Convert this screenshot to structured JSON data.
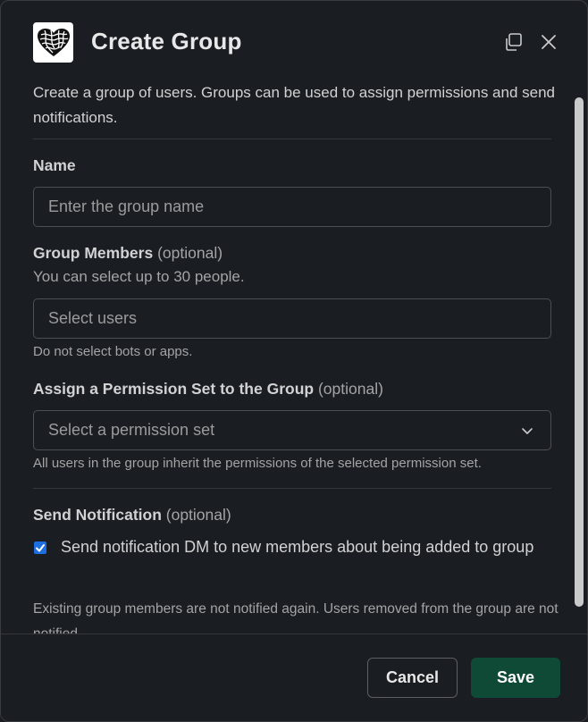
{
  "header": {
    "title": "Create Group",
    "icons": {
      "app": "heart-knot-logo-icon",
      "copy": "copy-icon",
      "close": "close-icon"
    }
  },
  "intro": "Create a group of users. Groups can be used to assign permissions and send notifications.",
  "name_field": {
    "label": "Name",
    "placeholder": "Enter the group name",
    "value": ""
  },
  "members_field": {
    "label": "Group Members",
    "optional": "(optional)",
    "sublabel": "You can select up to 30 people.",
    "placeholder": "Select users",
    "hint": "Do not select bots or apps."
  },
  "permission_field": {
    "label": "Assign a Permission Set to the Group",
    "optional": "(optional)",
    "placeholder": "Select a permission set",
    "hint": "All users in the group inherit the permissions of the selected permission set."
  },
  "notification": {
    "label": "Send Notification",
    "optional": "(optional)",
    "checkbox_label": "Send notification DM to new members about being added to group",
    "checked": true,
    "note": "Existing group members are not notified again. Users removed from the group are not notified."
  },
  "footer": {
    "cancel_label": "Cancel",
    "save_label": "Save"
  },
  "colors": {
    "background": "#1a1d21",
    "accent_save": "#0f4a36",
    "checkbox": "#1d6ee0"
  }
}
